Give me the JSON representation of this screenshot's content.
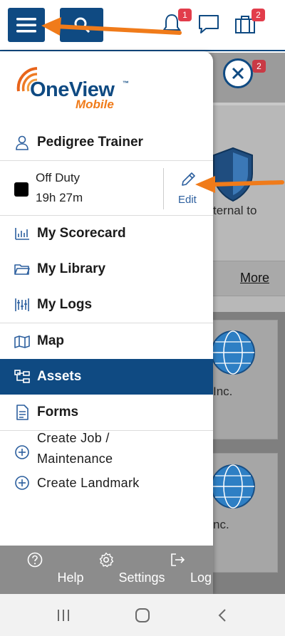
{
  "topbar": {
    "icons": [
      "menu-icon",
      "search-icon",
      "bell-icon",
      "chat-icon",
      "briefcase-icon"
    ],
    "bell_badge": "1",
    "briefcase_badge": "2"
  },
  "background": {
    "badge": "2",
    "partial_text": "ternal to",
    "more_label": "More",
    "card1_text": "Inc.",
    "card2_text": "nc."
  },
  "drawer": {
    "logo": {
      "name": "OneView",
      "tm": "™",
      "sub": "Mobile"
    },
    "user_name": "Pedigree Trainer",
    "status": {
      "label": "Off Duty",
      "duration": "19h 27m",
      "edit_label": "Edit"
    },
    "menu": [
      {
        "label": "My Scorecard",
        "icon": "scorecard-icon"
      },
      {
        "label": "My Library",
        "icon": "folder-icon"
      },
      {
        "label": "My Logs",
        "icon": "logs-icon"
      },
      {
        "label": "Map",
        "icon": "map-icon"
      },
      {
        "label": "Assets",
        "icon": "assets-icon",
        "active": true
      },
      {
        "label": "Forms",
        "icon": "forms-icon"
      }
    ],
    "actions": [
      {
        "label_line1": "Create Job /",
        "label_line2": "Maintenance",
        "icon": "plus-circle-icon"
      },
      {
        "label": "Create Landmark",
        "icon": "plus-circle-icon"
      }
    ],
    "footer": [
      {
        "label": "Help",
        "icon": "help-icon"
      },
      {
        "label": "Settings",
        "icon": "gear-icon"
      },
      {
        "label": "Log Out",
        "icon": "logout-icon"
      }
    ]
  },
  "colors": {
    "brand_blue": "#0f4a82",
    "accent_orange": "#f07b1a",
    "badge_red": "#e23d4b",
    "active_row": "#0f4a82"
  }
}
